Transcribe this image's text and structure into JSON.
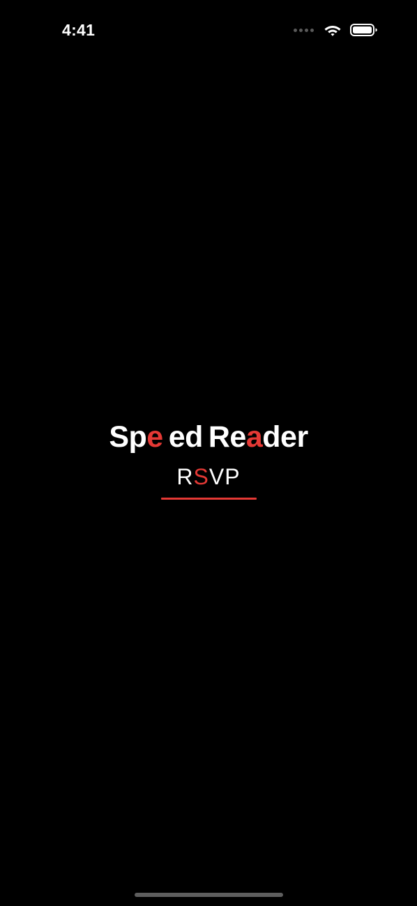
{
  "status_bar": {
    "time": "4:41",
    "wifi_icon": "wifi-icon",
    "battery_icon": "battery-icon"
  },
  "logo": {
    "title_word1_part1": "Sp",
    "title_word1_accent": "e",
    "title_word1_part2": "ed",
    "title_word2_part1": "Re",
    "title_word2_accent": "a",
    "title_word2_part2": "der",
    "subtitle_part1": "R",
    "subtitle_accent": "S",
    "subtitle_part2": "VP"
  },
  "colors": {
    "background": "#000000",
    "text": "#ffffff",
    "accent": "#e53935"
  }
}
